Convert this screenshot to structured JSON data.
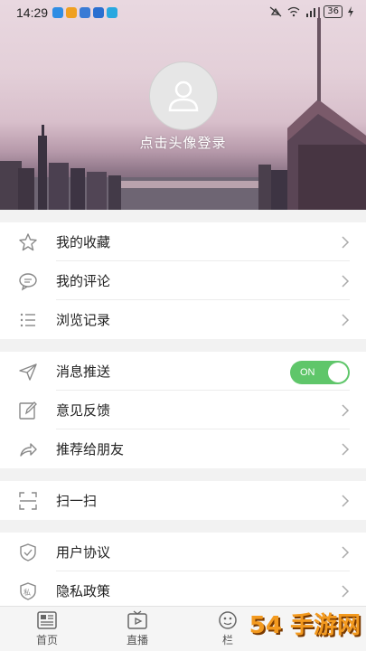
{
  "status_bar": {
    "time": "14:29",
    "battery": "36"
  },
  "profile": {
    "login_prompt": "点击头像登录"
  },
  "groups": [
    {
      "items": [
        {
          "label": "我的收藏",
          "icon": "star-icon"
        },
        {
          "label": "我的评论",
          "icon": "comment-icon"
        },
        {
          "label": "浏览记录",
          "icon": "list-icon"
        }
      ]
    },
    {
      "items": [
        {
          "label": "消息推送",
          "icon": "send-icon",
          "toggle": "ON"
        },
        {
          "label": "意见反馈",
          "icon": "edit-icon"
        },
        {
          "label": "推荐给朋友",
          "icon": "share-icon"
        }
      ]
    },
    {
      "items": [
        {
          "label": "扫一扫",
          "icon": "scan-icon"
        }
      ]
    },
    {
      "items": [
        {
          "label": "用户协议",
          "icon": "shield-icon"
        },
        {
          "label": "隐私政策",
          "icon": "privacy-icon"
        }
      ]
    }
  ],
  "tabbar": [
    {
      "label": "首页",
      "icon": "news-icon"
    },
    {
      "label": "直播",
      "icon": "live-icon"
    },
    {
      "label": "栏",
      "icon": "column-icon"
    }
  ],
  "watermark": "54 手游网",
  "colors": {
    "toggle_on": "#5fc66a",
    "watermark": "#f39a1f"
  }
}
